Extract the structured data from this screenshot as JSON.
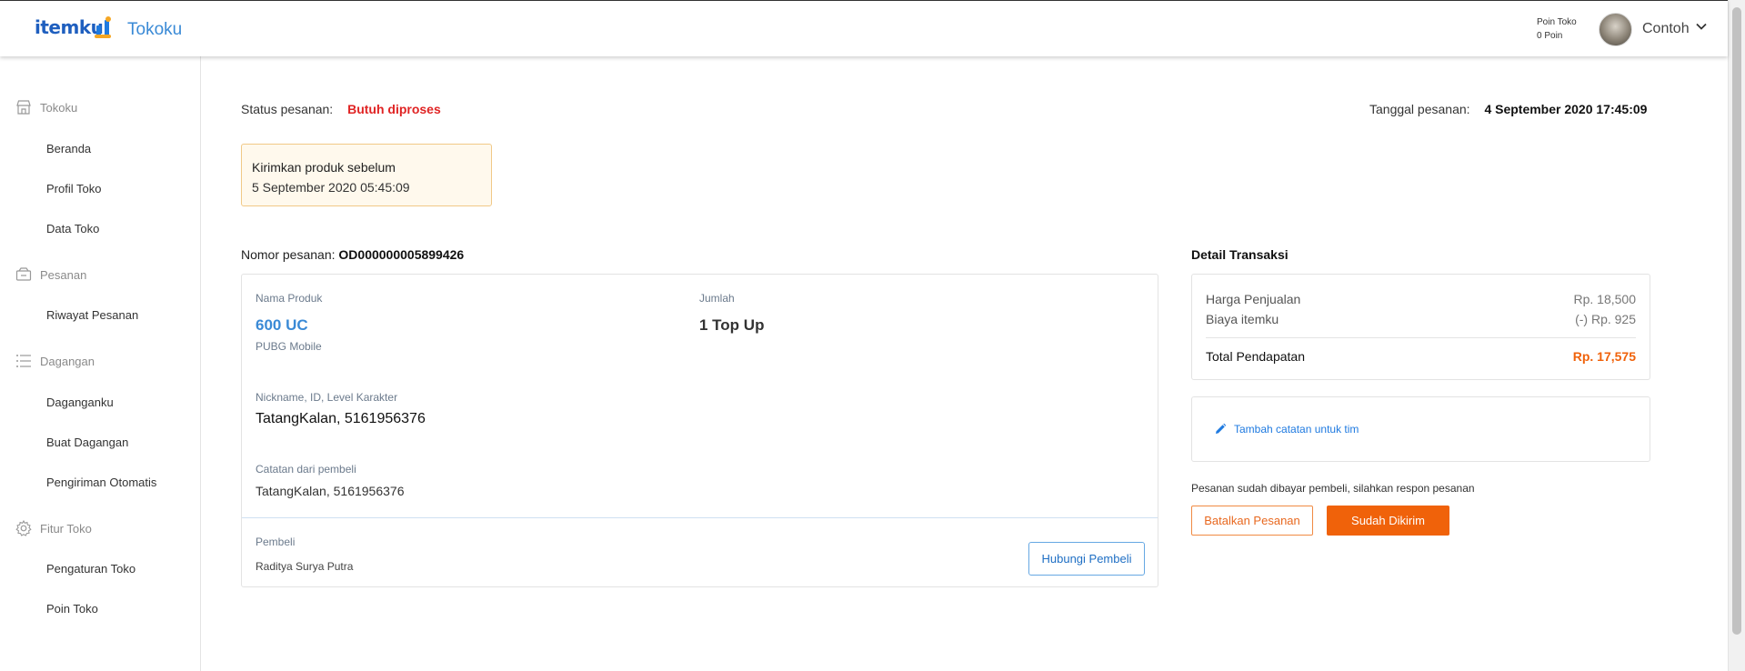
{
  "header": {
    "logo": "itemku",
    "app_title": "Tokoku",
    "poin_label": "Poin Toko",
    "poin_value": "0 Poin",
    "user_name": "Contoh"
  },
  "sidebar": {
    "sections": [
      {
        "title": "Tokoku",
        "icon": "store-icon",
        "items": [
          "Beranda",
          "Profil Toko",
          "Data Toko"
        ]
      },
      {
        "title": "Pesanan",
        "icon": "order-box-icon",
        "items": [
          "Riwayat Pesanan"
        ]
      },
      {
        "title": "Dagangan",
        "icon": "list-icon",
        "items": [
          "Daganganku",
          "Buat Dagangan",
          "Pengiriman Otomatis"
        ]
      },
      {
        "title": "Fitur Toko",
        "icon": "gear-icon",
        "items": [
          "Pengaturan Toko",
          "Poin Toko"
        ]
      }
    ]
  },
  "order": {
    "status_label": "Status pesanan:",
    "status_value": "Butuh diproses",
    "status_color": "#e02424",
    "date_label": "Tanggal pesanan:",
    "date_value": "4 September 2020 17:45:09",
    "deadline_title": "Kirimkan produk sebelum",
    "deadline_value": "5 September 2020 05:45:09",
    "number_label": "Nomor pesanan:",
    "number_value": "OD000000005899426",
    "product_label": "Nama Produk",
    "product_name": "600 UC",
    "product_game": "PUBG Mobile",
    "qty_label": "Jumlah",
    "qty_value": "1 Top Up",
    "nickname_label": "Nickname, ID, Level Karakter",
    "nickname_value": "TatangKalan, 5161956376",
    "note_label": "Catatan dari pembeli",
    "note_value": "TatangKalan, 5161956376",
    "buyer_label": "Pembeli",
    "buyer_name": "Raditya Surya Putra",
    "contact_button": "Hubungi Pembeli"
  },
  "transaction": {
    "title": "Detail Transaksi",
    "sale_label": "Harga Penjualan",
    "sale_value": "Rp. 18,500",
    "fee_label": "Biaya itemku",
    "fee_value": "(-) Rp. 925",
    "total_label": "Total Pendapatan",
    "total_value": "Rp. 17,575",
    "add_note": "Tambah catatan untuk tim",
    "paid_message": "Pesanan sudah dibayar pembeli, silahkan respon pesanan",
    "cancel_button": "Batalkan Pesanan",
    "sent_button": "Sudah Dikirim"
  },
  "colors": {
    "brand_blue": "#1f5fbf",
    "accent_orange": "#f0620a",
    "link_blue": "#1f7ae0"
  }
}
